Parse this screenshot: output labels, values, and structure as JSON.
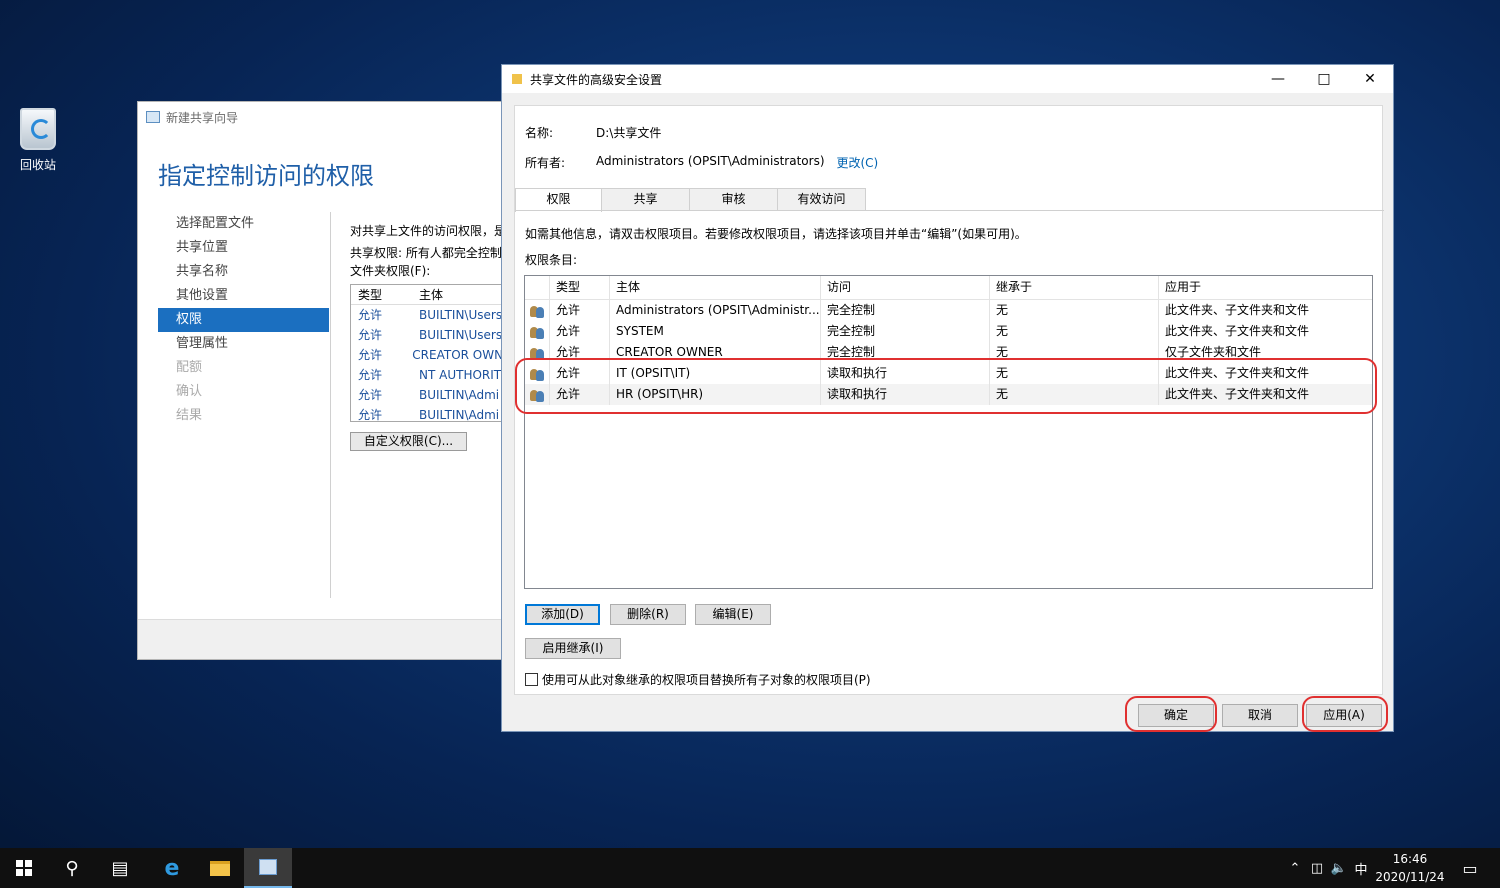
{
  "desktop": {
    "recycle_bin_label": "回收站"
  },
  "wizard": {
    "title": "新建共享向导",
    "heading": "指定控制访问的权限",
    "nav": [
      "选择配置文件",
      "共享位置",
      "共享名称",
      "其他设置",
      "权限",
      "管理属性",
      "配额",
      "确认",
      "结果"
    ],
    "desc": "对共享上文件的访问权限，是",
    "share_perm": "共享权限: 所有人都完全控制",
    "folder_perm_label": "文件夹权限(F):",
    "table_headers": [
      "类型",
      "主体"
    ],
    "rows": [
      [
        "允许",
        "BUILTIN\\Users"
      ],
      [
        "允许",
        "BUILTIN\\Users"
      ],
      [
        "允许",
        "CREATOR OWNER"
      ],
      [
        "允许",
        "NT AUTHORITY"
      ],
      [
        "允许",
        "BUILTIN\\Admi"
      ],
      [
        "允许",
        "BUILTIN\\Admi"
      ]
    ],
    "custom_btn": "自定义权限(C)..."
  },
  "dialog": {
    "title": "共享文件的高级安全设置",
    "name_label": "名称:",
    "name_value": "D:\\共享文件",
    "owner_label": "所有者:",
    "owner_value": "Administrators (OPSIT\\Administrators)",
    "change_link": "更改(C)",
    "tabs": [
      "权限",
      "共享",
      "审核",
      "有效访问"
    ],
    "info_text": "如需其他信息，请双击权限项目。若要修改权限项目，请选择该项目并单击“编辑”(如果可用)。",
    "entries_label": "权限条目:",
    "columns": [
      "类型",
      "主体",
      "访问",
      "继承于",
      "应用于"
    ],
    "entries": [
      {
        "type": "允许",
        "principal": "Administrators (OPSIT\\Administr...",
        "access": "完全控制",
        "inherited": "无",
        "applies": "此文件夹、子文件夹和文件"
      },
      {
        "type": "允许",
        "principal": "SYSTEM",
        "access": "完全控制",
        "inherited": "无",
        "applies": "此文件夹、子文件夹和文件"
      },
      {
        "type": "允许",
        "principal": "CREATOR OWNER",
        "access": "完全控制",
        "inherited": "无",
        "applies": "仅子文件夹和文件"
      },
      {
        "type": "允许",
        "principal": "IT (OPSIT\\IT)",
        "access": "读取和执行",
        "inherited": "无",
        "applies": "此文件夹、子文件夹和文件"
      },
      {
        "type": "允许",
        "principal": "HR (OPSIT\\HR)",
        "access": "读取和执行",
        "inherited": "无",
        "applies": "此文件夹、子文件夹和文件"
      }
    ],
    "add_btn": "添加(D)",
    "remove_btn": "删除(R)",
    "edit_btn": "编辑(E)",
    "enable_inherit_btn": "启用继承(I)",
    "replace_checkbox": "使用可从此对象继承的权限项目替换所有子对象的权限项目(P)",
    "ok_btn": "确定",
    "cancel_btn": "取消",
    "apply_btn": "应用(A)"
  },
  "taskbar": {
    "time": "16:46",
    "date": "2020/11/24",
    "ime": "中"
  },
  "colors": {
    "accent": "#1b6fc0",
    "highlight_ring": "#e03030",
    "link": "#0063b1"
  }
}
